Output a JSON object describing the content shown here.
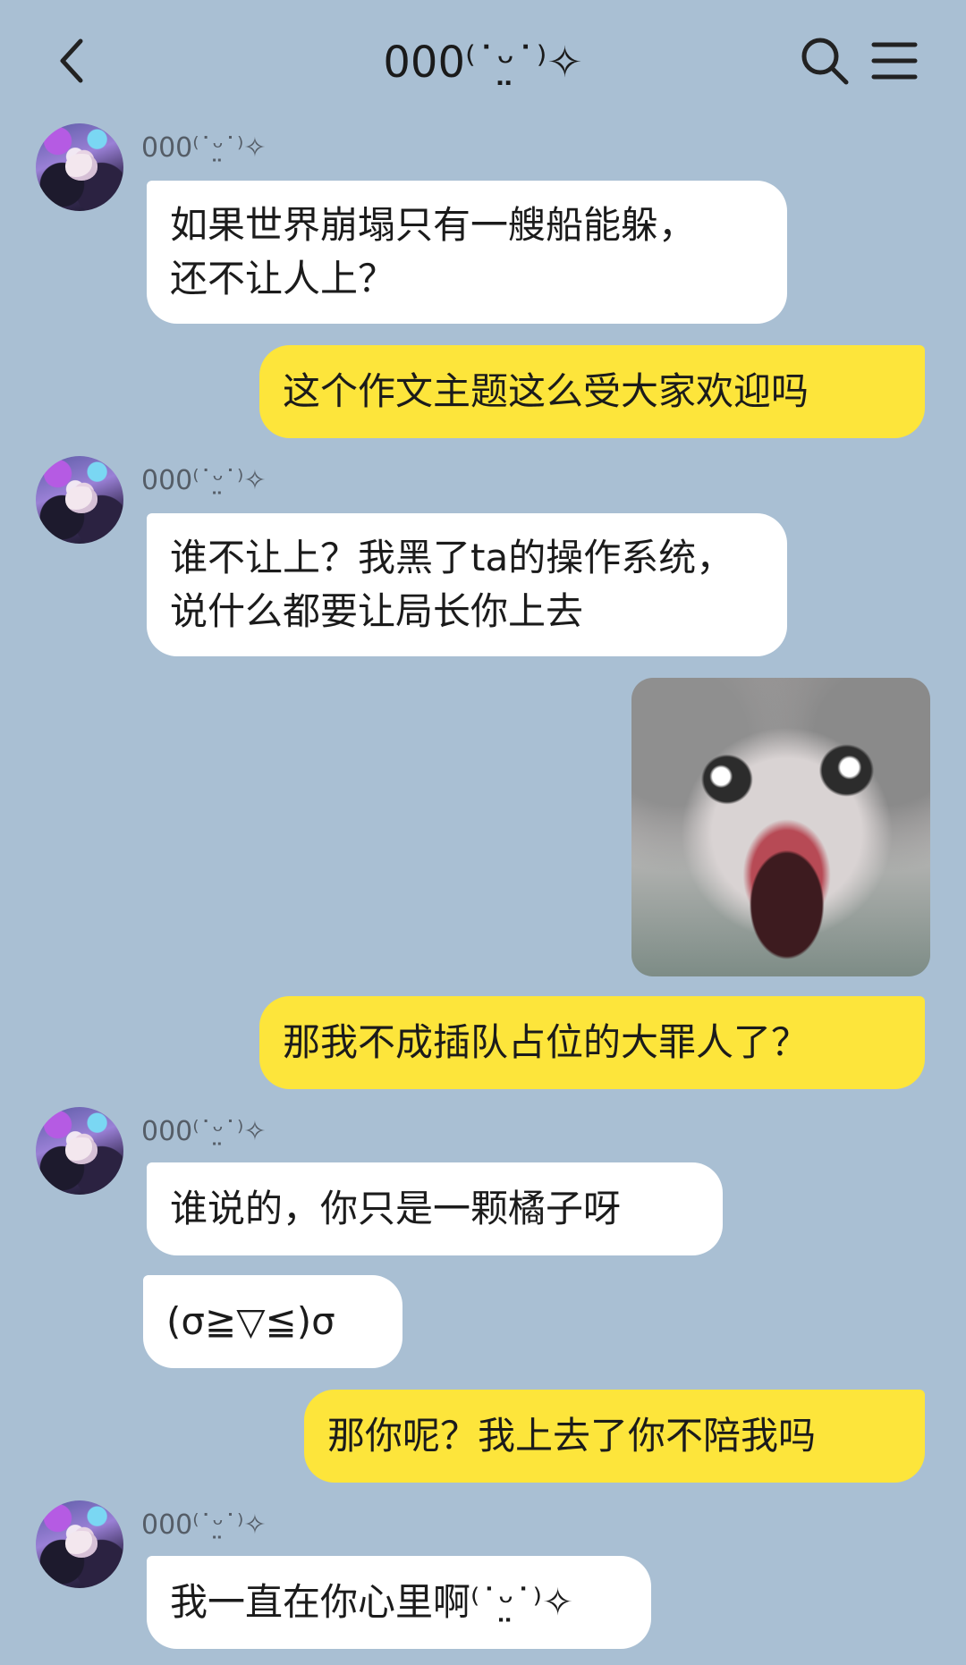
{
  "header": {
    "title": "000⁽˙ᵕ̤˙⁾✧",
    "back_icon": "chevron-left-icon",
    "search_icon": "search-icon",
    "menu_icon": "hamburger-menu-icon"
  },
  "messages": [
    {
      "sender_name": "000⁽˙ᵕ̤˙⁾✧",
      "text": "如果世界崩塌只有一艘船能躲，还不让人上？"
    },
    {
      "text": "这个作文主题这么受大家欢迎吗"
    },
    {
      "sender_name": "000⁽˙ᵕ̤˙⁾✧",
      "text": "谁不让上？我黑了ta的操作系统，说什么都要让局长你上去"
    },
    {
      "sticker": "screaming-cat-sticker"
    },
    {
      "text": "那我不成插队占位的大罪人了？"
    },
    {
      "sender_name": "000⁽˙ᵕ̤˙⁾✧",
      "text": "谁说的，你只是一颗橘子呀"
    },
    {
      "text": "(σ≧▽≦)σ"
    },
    {
      "text": "那你呢？我上去了你不陪我吗"
    },
    {
      "sender_name": "000⁽˙ᵕ̤˙⁾✧",
      "text": "我一直在你心里啊⁽˙ᵕ̤˙⁾✧"
    }
  ],
  "colors": {
    "background": "#a9bfd3",
    "incoming_bubble": "#ffffff",
    "outgoing_bubble": "#fde53b"
  }
}
